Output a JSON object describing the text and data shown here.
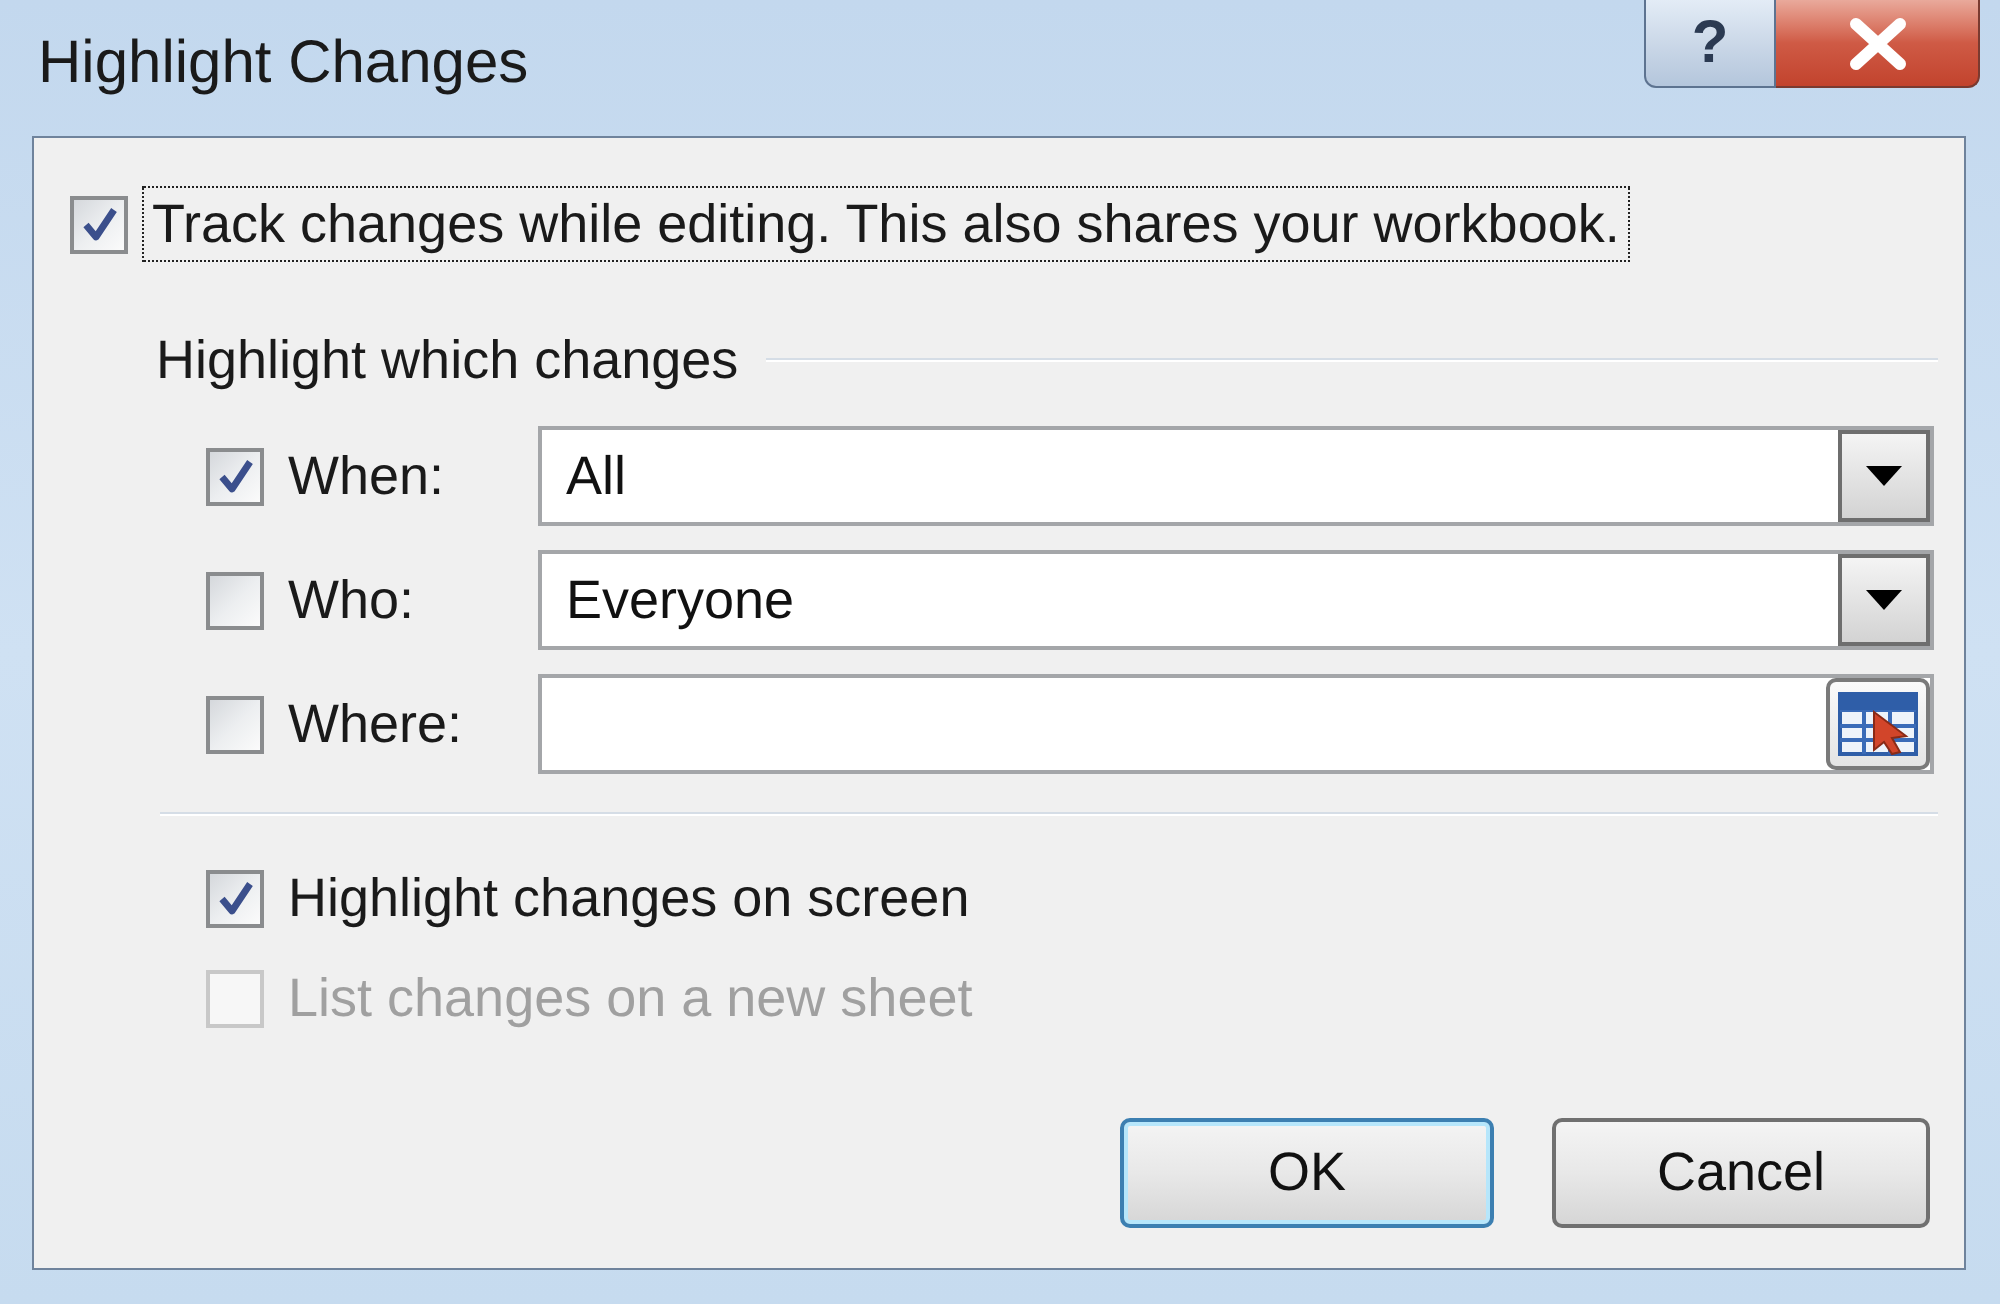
{
  "window": {
    "title": "Highlight Changes",
    "help_button": {
      "label": "?"
    }
  },
  "track_changes": {
    "label": "Track changes while editing. This also shares your workbook.",
    "checked": true,
    "focused": true
  },
  "highlight_group": {
    "title": "Highlight which changes",
    "filters": [
      {
        "label": "When:",
        "checked": true,
        "kind": "dropdown",
        "value": "All"
      },
      {
        "label": "Who:",
        "checked": false,
        "kind": "dropdown",
        "value": "Everyone"
      },
      {
        "label": "Where:",
        "checked": false,
        "kind": "range"
      }
    ]
  },
  "options": [
    {
      "label": "Highlight changes on screen",
      "checked": true,
      "disabled": false
    },
    {
      "label": "List changes on a new sheet",
      "checked": false,
      "disabled": true
    }
  ],
  "buttons": [
    {
      "label": "OK",
      "default": true
    },
    {
      "label": "Cancel",
      "default": false
    }
  ]
}
